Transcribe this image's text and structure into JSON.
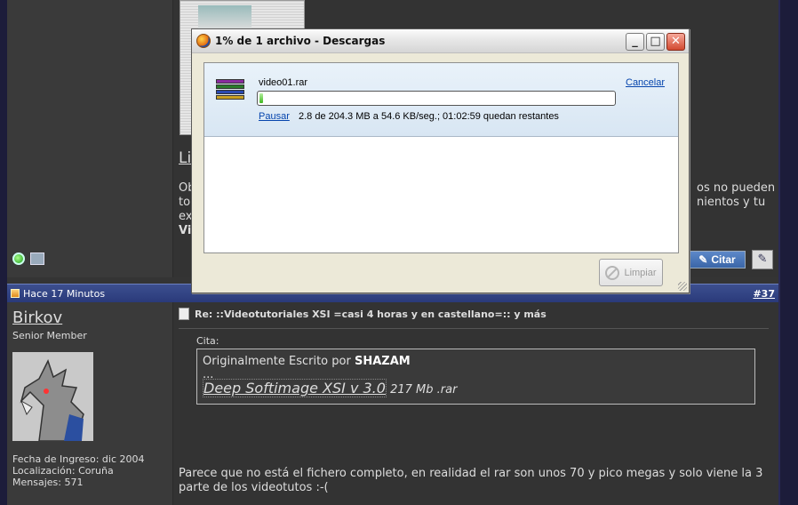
{
  "download_window": {
    "title": "1% de 1 archivo - Descargas",
    "minimize": "_",
    "maximize": "□",
    "close": "✕",
    "item": {
      "filename": "video01.rar",
      "cancel_label": "Cancelar",
      "pause_label": "Pausar",
      "status_text": "2.8 de 204.3 MB a 54.6 KB/seg.; 01:02:59 quedan restantes",
      "progress_percent": 1
    },
    "clear_label": "Limpiar"
  },
  "top_post": {
    "link_fragment": "Li",
    "text_line1_left": "Ob",
    "text_line2_left": "to",
    "text_line3_left": "ex",
    "text_line4_left": "Vi",
    "text_line1_right": "os no pueden",
    "text_line2_right": "nientos y tu",
    "quote_button": "Citar"
  },
  "post_header": {
    "time": "Hace 17 Minutos",
    "post_number": "#37"
  },
  "post": {
    "username": "Birkov",
    "user_title": "Senior Member",
    "join_date": "Fecha de Ingreso: dic 2004",
    "location": "Localización: Coruña",
    "messages": "Mensajes: 571",
    "title": "Re: ::Videotutoriales XSI =casi 4 horas y en castellano=:: y más",
    "quote_label": "Cita:",
    "quote_by_prefix": "Originalmente Escrito por",
    "quote_author": "SHAZAM",
    "quote_ellipsis": "...",
    "quote_link": "Deep Softimage XSI v 3.0",
    "quote_size": "217 Mb .rar",
    "body": "Parece que no está el fichero completo, en realidad el rar son unos 70 y pico megas y solo viene la 3 parte de los videotutos :-("
  }
}
